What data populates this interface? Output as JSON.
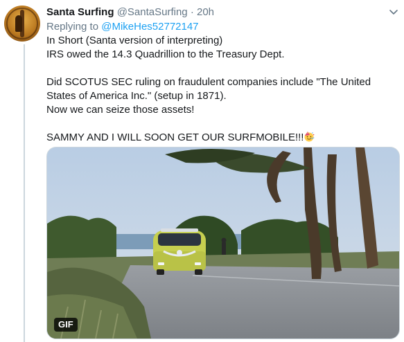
{
  "tweet": {
    "display_name": "Santa Surfing",
    "handle": "@SantaSurfing",
    "separator": "·",
    "time": "20h",
    "replying_prefix": "Replying to",
    "replying_to": "@MikeHes52772147",
    "lines": [
      "In Short (Santa version of interpreting)",
      "IRS owed the 14.3 Quadrillion to the Treasury Dept.",
      "Did SCOTUS SEC ruling on fraudulent companies include \"The United States of America Inc.\" (setup in 1871).",
      "Now we can seize those assets!",
      "SAMMY AND I WILL SOON GET OUR SURFMOBILE!!!"
    ],
    "emoji_icon": "partying-face-icon",
    "media_badge": "GIF"
  },
  "colors": {
    "link": "#1da1f2",
    "secondary_text": "#657786",
    "primary_text": "#14171a",
    "thread_line": "#ccd6dd"
  }
}
